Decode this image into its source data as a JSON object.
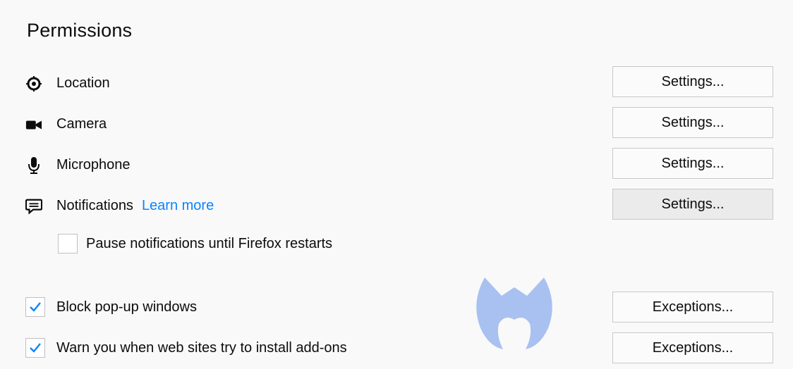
{
  "section": {
    "title": "Permissions"
  },
  "permissions": [
    {
      "id": "location",
      "icon": "location-icon",
      "label": "Location",
      "button_label": "Settings..."
    },
    {
      "id": "camera",
      "icon": "camera-icon",
      "label": "Camera",
      "button_label": "Settings..."
    },
    {
      "id": "microphone",
      "icon": "microphone-icon",
      "label": "Microphone",
      "button_label": "Settings..."
    },
    {
      "id": "notifications",
      "icon": "notifications-icon",
      "label": "Notifications",
      "link": "Learn more",
      "button_label": "Settings..."
    }
  ],
  "pause_notifications": {
    "label": "Pause notifications until Firefox restarts",
    "checked": false
  },
  "block_popups": {
    "label": "Block pop-up windows",
    "checked": true,
    "button_label": "Exceptions..."
  },
  "warn_addons": {
    "label": "Warn you when web sites try to install add-ons",
    "checked": true,
    "button_label": "Exceptions..."
  },
  "colors": {
    "link": "#0a84ff",
    "checkmark": "#0a84ff",
    "watermark": "#a9c1f0"
  }
}
